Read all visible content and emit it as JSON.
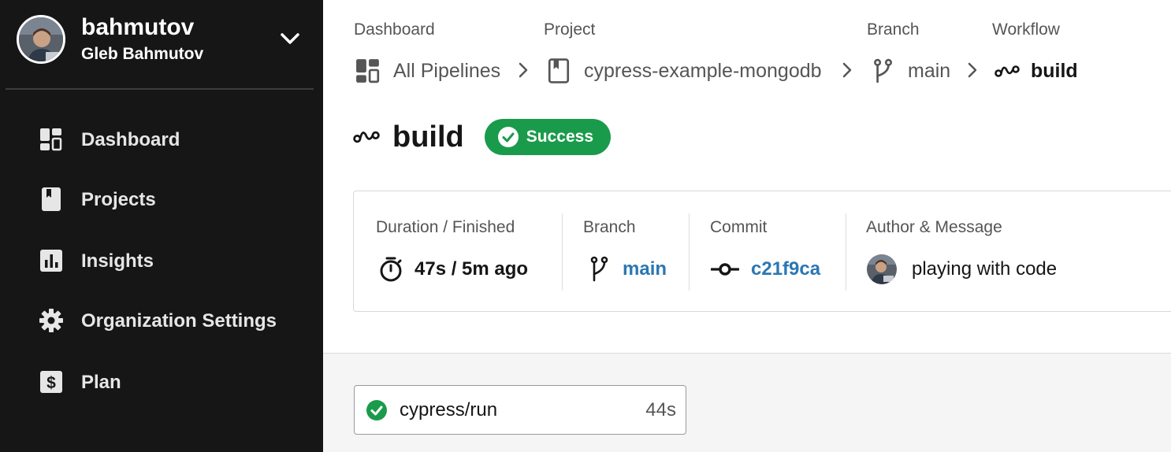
{
  "account": {
    "username": "bahmutov",
    "full_name": "Gleb Bahmutov"
  },
  "sidebar": {
    "items": [
      {
        "label": "Dashboard",
        "icon": "dashboard-icon"
      },
      {
        "label": "Projects",
        "icon": "project-book-icon"
      },
      {
        "label": "Insights",
        "icon": "insights-chart-icon"
      },
      {
        "label": "Organization Settings",
        "icon": "gear-icon"
      },
      {
        "label": "Plan",
        "icon": "dollar-icon"
      }
    ]
  },
  "breadcrumb": {
    "dashboard": {
      "heading": "Dashboard",
      "label": "All Pipelines"
    },
    "project": {
      "heading": "Project",
      "label": "cypress-example-mongodb"
    },
    "branch": {
      "heading": "Branch",
      "label": "main"
    },
    "workflow": {
      "heading": "Workflow",
      "label": "build"
    }
  },
  "workflow": {
    "title": "build",
    "status": "Success"
  },
  "info": {
    "duration_label": "Duration / Finished",
    "duration_value": "47s / 5m ago",
    "branch_label": "Branch",
    "branch_value": "main",
    "commit_label": "Commit",
    "commit_value": "c21f9ca",
    "author_label": "Author & Message",
    "message": "playing with code"
  },
  "jobs": [
    {
      "name": "cypress/run",
      "duration": "44s",
      "status": "success"
    }
  ],
  "colors": {
    "sidebar_bg": "#161616",
    "success": "#1a9b4b",
    "link": "#2b77b3",
    "lower_bg": "#f5f5f5"
  }
}
